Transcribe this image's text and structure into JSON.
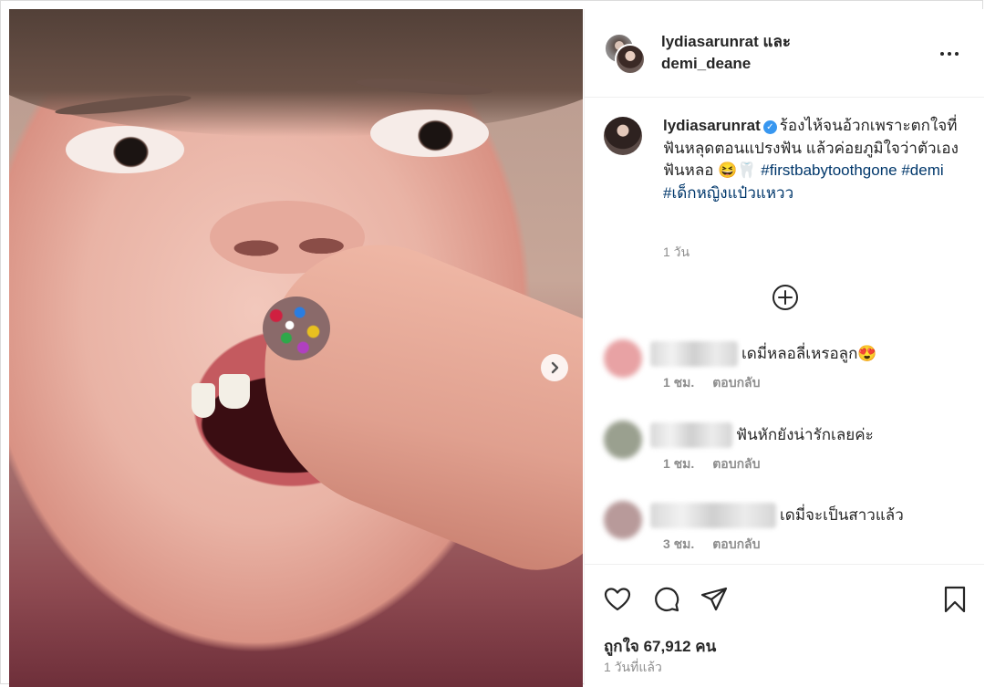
{
  "post": {
    "header_title": "lydiasarunrat และ\ndemi_deane",
    "caption_user": "lydiasarunrat",
    "caption_text": "ร้องไห้จนอ้วกเพราะตกใจที่ฟันหลุดตอนแปรงฟัน แล้วค่อยภูมิใจว่าตัวเองฟันหลอ 😆🦷",
    "hashtags": "#firstbabytoothgone #demi #เด็กหญิงแป๋วแหวว",
    "caption_time": "1 วัน",
    "likes": "ถูกใจ 67,912 คน",
    "posted_ago": "1 วันที่แล้ว"
  },
  "comments": [
    {
      "text": "เดมี่หลอลี่เหรอลูก😍",
      "time": "1 ชม.",
      "reply": "ตอบกลับ",
      "avatar_color": "#e8a2a4"
    },
    {
      "text": "ฟันหักยังน่ารักเลยค่ะ",
      "time": "1 ชม.",
      "reply": "ตอบกลับ",
      "avatar_color": "#9aa08f"
    },
    {
      "text": "เดมี่จะเป็นสาวแล้ว",
      "time": "3 ชม.",
      "reply": "ตอบกลับ",
      "avatar_color": "#b89a9a"
    }
  ],
  "icons": [
    "more-icon",
    "verified-icon",
    "add-circle-icon",
    "chevron-right-icon",
    "heart-icon",
    "comment-icon",
    "share-icon",
    "bookmark-icon"
  ],
  "colors": {
    "hashtag": "#00376b",
    "verified": "#3897f0",
    "muted": "#8e8e8e",
    "text": "#262626"
  }
}
